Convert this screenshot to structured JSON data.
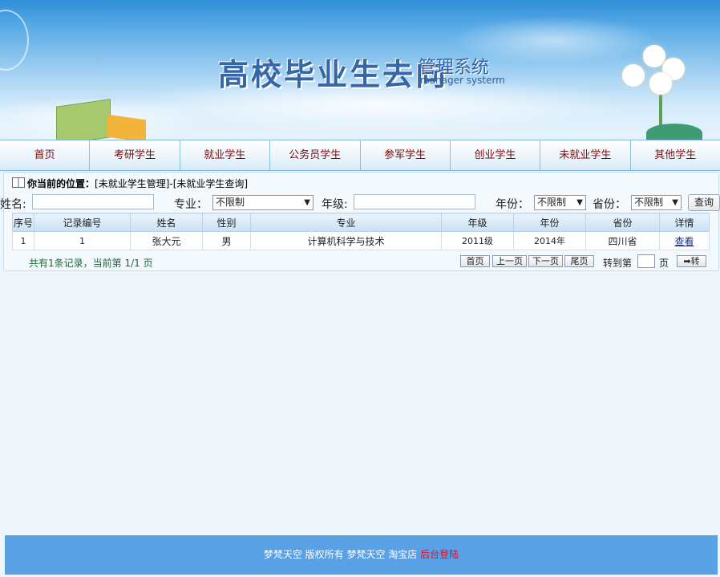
{
  "header": {
    "title": "高校毕业生去向",
    "subtitle": "管理系统",
    "subtitle_en": "manager systerm"
  },
  "nav": {
    "items": [
      "首页",
      "考研学生",
      "就业学生",
      "公务员学生",
      "参军学生",
      "创业学生",
      "未就业学生",
      "其他学生"
    ]
  },
  "breadcrumb": {
    "label": "你当前的位置：",
    "path": "[未就业学生管理]-[未就业学生查询]"
  },
  "search": {
    "name_label": "姓名:",
    "name_value": "",
    "major_label": "专业：",
    "major_value": "不限制",
    "grade_label": "年级:",
    "grade_value": "",
    "year_label": "年份：",
    "year_value": "不限制",
    "province_label": "省份：",
    "province_value": "不限制",
    "query_button": "查询"
  },
  "table": {
    "columns": [
      "序号",
      "记录编号",
      "姓名",
      "性别",
      "专业",
      "年级",
      "年份",
      "省份",
      "详情"
    ],
    "rows": [
      [
        "1",
        "1",
        "张大元",
        "男",
        "计算机科学与技术",
        "2011级",
        "2014年",
        "四川省",
        "查看"
      ]
    ]
  },
  "pager": {
    "info": "共有1条记录，当前第 1/1 页",
    "first": "首页",
    "prev": "上一页",
    "next": "下一页",
    "last": "尾页",
    "goto_label": "转到第",
    "page_unit": "页",
    "goto_button": "➡转"
  },
  "footer": {
    "text": "梦梵天空 版权所有 梦梵天空 淘宝店",
    "login_link": "后台登陆"
  }
}
